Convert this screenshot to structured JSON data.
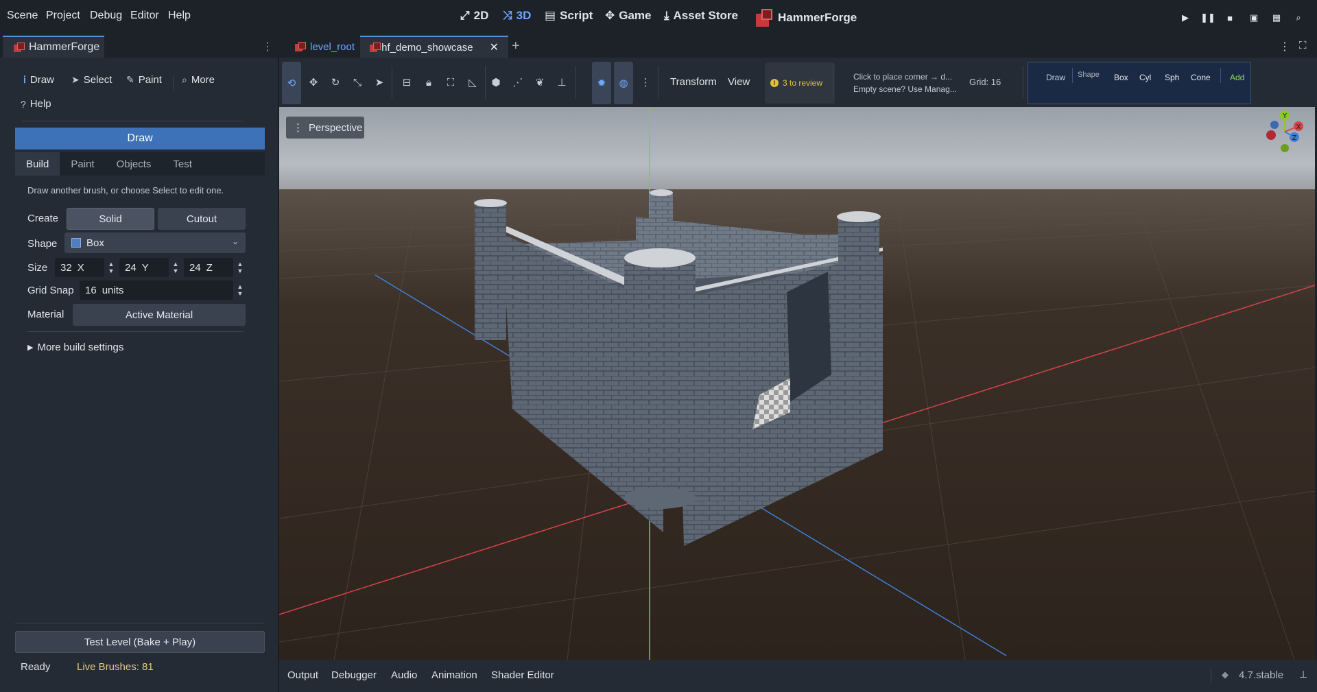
{
  "menu": [
    "Scene",
    "Project",
    "Debug",
    "Editor",
    "Help"
  ],
  "workspaces": {
    "two_d": "2D",
    "three_d": "3D",
    "script": "Script",
    "game": "Game",
    "asset_store": "Asset Store",
    "plugin": "HammerForge"
  },
  "left_dock": {
    "tab": "HammerForge",
    "tools": {
      "draw": "Draw",
      "select": "Select",
      "paint": "Paint",
      "more": "More",
      "help": "Help"
    },
    "banner": "Draw",
    "subtabs": [
      "Build",
      "Paint",
      "Objects",
      "Test"
    ],
    "hint": "Draw another brush, or choose Select to edit one.",
    "create_label": "Create",
    "solid": "Solid",
    "cutout": "Cutout",
    "shape_label": "Shape",
    "shape_value": "Box",
    "size_label": "Size",
    "size_x": "32",
    "size_x_axis": "X",
    "size_y": "24",
    "size_y_axis": "Y",
    "size_z": "24",
    "size_z_axis": "Z",
    "gridsnap_label": "Grid Snap",
    "gridsnap_value": "16",
    "gridsnap_unit": "units",
    "material_label": "Material",
    "material_value": "Active Material",
    "more_settings": "More build settings",
    "test_level": "Test Level  (Bake + Play)",
    "status": "Ready",
    "live_brushes": "Live Brushes: 81"
  },
  "scene_tabs": [
    "level_root",
    "hf_demo_showcase"
  ],
  "toolbar": {
    "transform": "Transform",
    "view": "View",
    "review": "3 to review",
    "hint_line1": "Click to place corner → d...",
    "hint_line2": "Empty scene? Use Manag...",
    "grid": "Grid: 16",
    "shapebar": {
      "draw": "Draw",
      "shape": "Shape",
      "box": "Box",
      "cyl": "Cyl",
      "sph": "Sph",
      "cone": "Cone",
      "add": "Add"
    }
  },
  "viewport": {
    "mode": "Perspective",
    "gizmo": {
      "x": "X",
      "y": "Y",
      "z": "Z"
    }
  },
  "bottom_tabs": [
    "Output",
    "Debugger",
    "Audio",
    "Animation",
    "Shader Editor"
  ],
  "version": "4.7.stable",
  "colors": {
    "accent": "#3d72b8",
    "axis_x": "#d9414a",
    "axis_y": "#8ac926",
    "axis_z": "#3f7fd8",
    "warning": "#e0c040",
    "live_brushes": "#e0c98a"
  }
}
